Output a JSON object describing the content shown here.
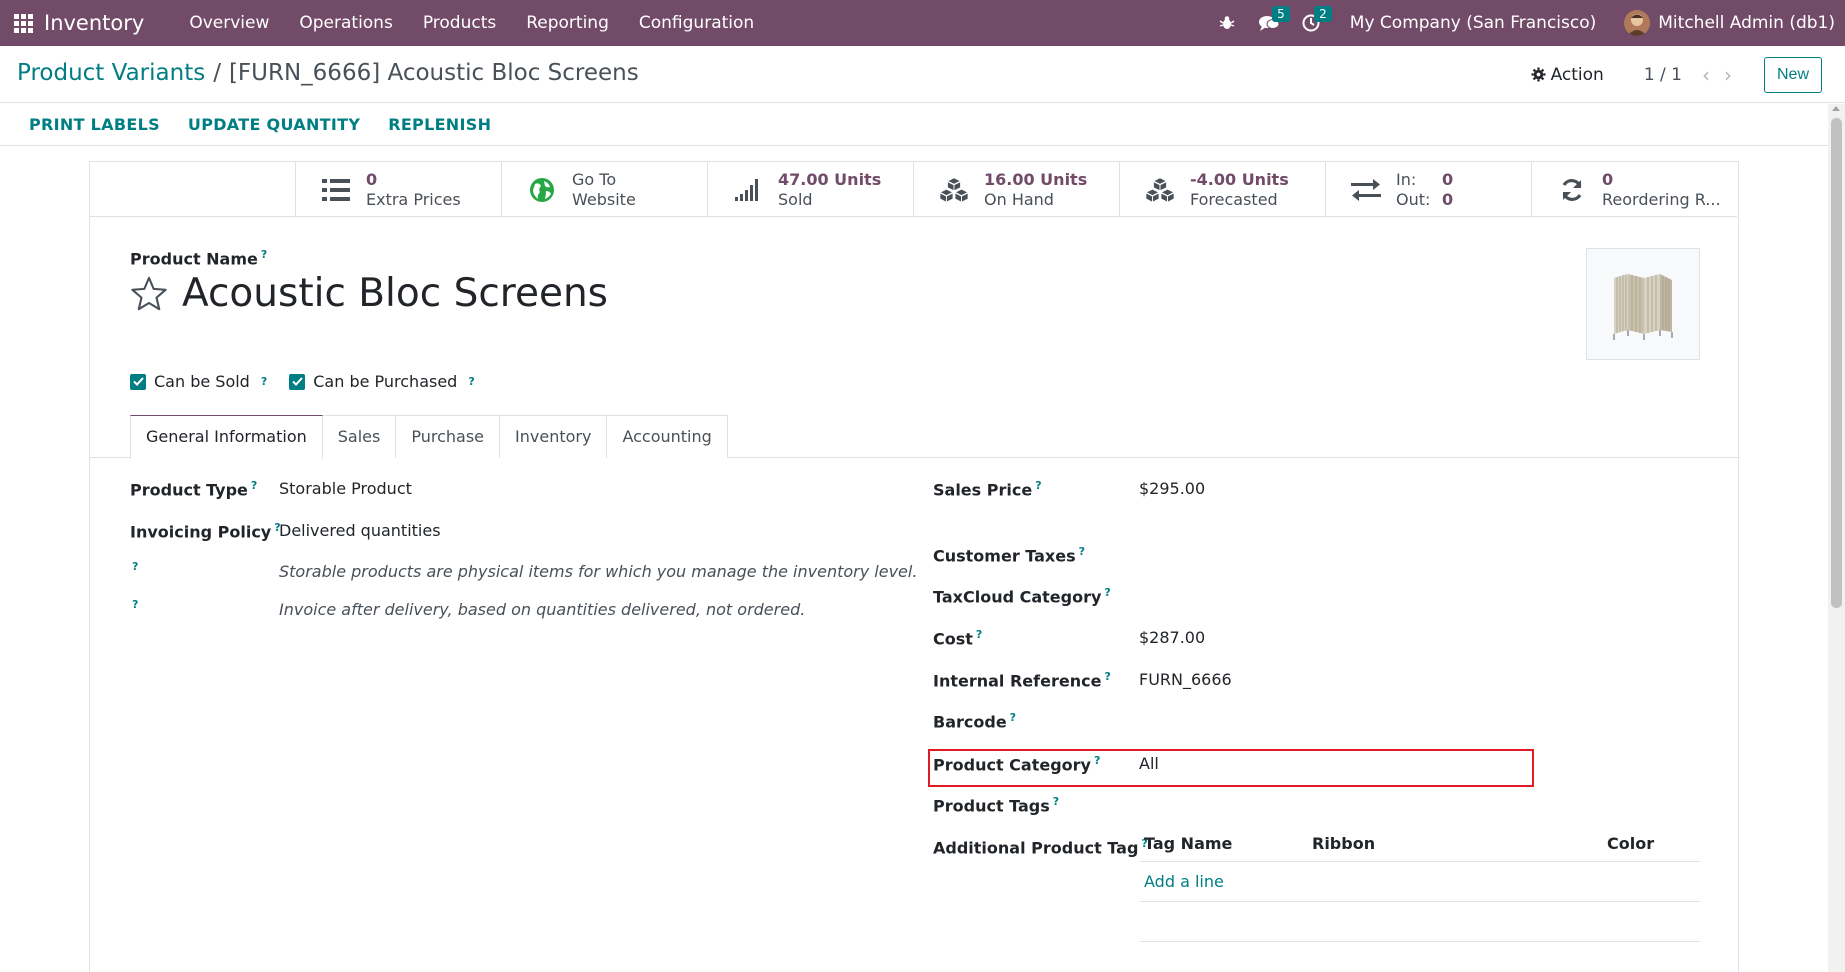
{
  "navbar": {
    "app_name": "Inventory",
    "menu": [
      "Overview",
      "Operations",
      "Products",
      "Reporting",
      "Configuration"
    ],
    "messages_count": "5",
    "activities_count": "2",
    "company": "My Company (San Francisco)",
    "user": "Mitchell Admin (db1)",
    "colors": {
      "brand": "#714B67",
      "accent": "#017e84"
    }
  },
  "breadcrumb": {
    "parent": "Product Variants",
    "separator": "/",
    "current": "[FURN_6666] Acoustic Bloc Screens"
  },
  "control": {
    "action_label": "Action",
    "pager": "1 / 1",
    "new_label": "New"
  },
  "statusbar": {
    "buttons": [
      "PRINT LABELS",
      "UPDATE QUANTITY",
      "REPLENISH"
    ]
  },
  "stats": [
    {
      "icon": "list-icon",
      "value": "0",
      "label": "Extra Prices"
    },
    {
      "icon": "globe-icon",
      "value": "Go To",
      "label": "Website"
    },
    {
      "icon": "signal-icon",
      "value": "47.00 Units",
      "label": "Sold"
    },
    {
      "icon": "cubes-icon",
      "value": "16.00 Units",
      "label": "On Hand"
    },
    {
      "icon": "cubes-icon",
      "value": "-4.00 Units",
      "label": "Forecasted"
    },
    {
      "icon": "exchange-icon",
      "in_label": "In:",
      "in_value": "0",
      "out_label": "Out:",
      "out_value": "0"
    },
    {
      "icon": "refresh-icon",
      "value": "0",
      "label": "Reordering R..."
    }
  ],
  "product": {
    "name_label": "Product Name",
    "name": "Acoustic Bloc Screens",
    "can_be_sold": "Can be Sold",
    "can_be_purchased": "Can be Purchased"
  },
  "tabs": [
    "General Information",
    "Sales",
    "Purchase",
    "Inventory",
    "Accounting"
  ],
  "left_fields": {
    "product_type_label": "Product Type",
    "product_type_value": "Storable Product",
    "invoicing_policy_label": "Invoicing Policy",
    "invoicing_policy_value": "Delivered quantities",
    "help_type": "Storable products are physical items for which you manage the inventory level.",
    "help_invoice": "Invoice after delivery, based on quantities delivered, not ordered."
  },
  "right_fields": {
    "sales_price_label": "Sales Price",
    "sales_price_value": "$295.00",
    "customer_taxes_label": "Customer Taxes",
    "taxcloud_label": "TaxCloud Category",
    "cost_label": "Cost",
    "cost_value": "$287.00",
    "internal_ref_label": "Internal Reference",
    "internal_ref_value": "FURN_6666",
    "barcode_label": "Barcode",
    "category_label": "Product Category",
    "category_value": "All",
    "tags_label": "Product Tags",
    "additional_tag_label": "Additional Product Tag"
  },
  "tag_table": {
    "columns": [
      "Tag Name",
      "Ribbon",
      "Color"
    ],
    "add_line": "Add a line"
  }
}
